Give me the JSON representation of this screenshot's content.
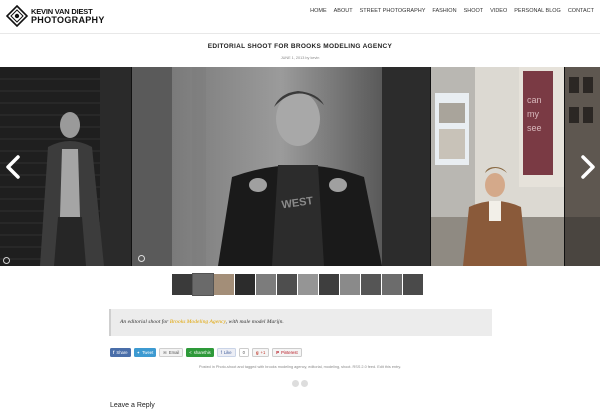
{
  "header": {
    "logo_line1": "KEVIN VAN DIEST",
    "logo_line2": "PHOTOGRAPHY",
    "nav": [
      "HOME",
      "ABOUT",
      "STREET PHOTOGRAPHY",
      "FASHION",
      "SHOOT",
      "VIDEO",
      "PERSONAL BLOG",
      "CONTACT"
    ]
  },
  "post": {
    "title": "EDITORIAL SHOOT FOR BROOKS MODELING AGENCY",
    "meta": "JUNE 1, 2013 by kevin"
  },
  "gallery": {
    "prev_icon": "chevron-left-icon",
    "next_icon": "chevron-right-icon",
    "thumbnail_count": 12,
    "active_thumbnail": 1
  },
  "caption": {
    "prefix": "An editorial shoot for ",
    "link": "Brooks Modeling Agency",
    "suffix": ", with male model Marijn."
  },
  "share": {
    "facebook": "Share",
    "twitter": "Tweet",
    "email": "Email",
    "sharethis": "sharethis",
    "like": "Like",
    "like_count": "0",
    "gplus": "+1",
    "pinterest": "Pinterest"
  },
  "footer": {
    "posted_in": "Posted in Photo-shoot and tagged with brooks modeling agency, editorial, modeling, shoot. RSS 2.0 feed. Edit this entry.",
    "more_heading": "Leave a Reply"
  },
  "colors": {
    "accent": "#e0a400",
    "facebook": "#4a6ea9",
    "twitter": "#3d9ad1",
    "sharethis": "#2e9a3a"
  }
}
